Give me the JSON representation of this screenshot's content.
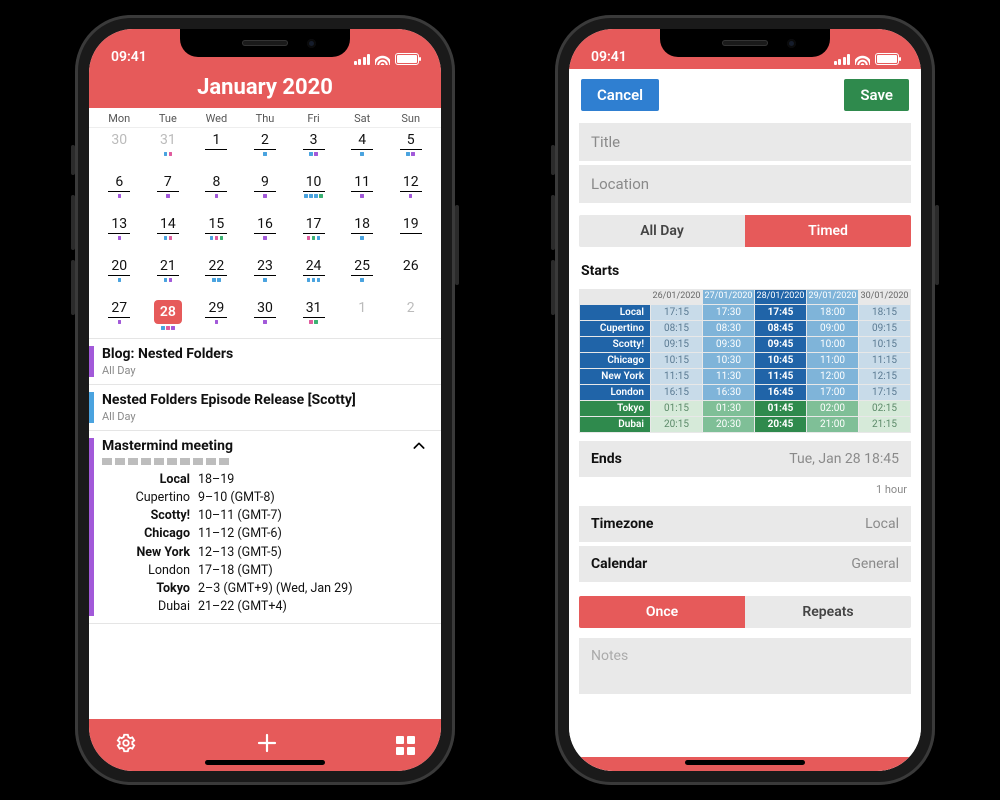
{
  "status": {
    "time": "09:41"
  },
  "calendar": {
    "title": "January 2020",
    "weekdays": [
      "Mon",
      "Tue",
      "Wed",
      "Thu",
      "Fri",
      "Sat",
      "Sun"
    ],
    "weeks": [
      [
        {
          "n": "30",
          "other": true,
          "dots": []
        },
        {
          "n": "31",
          "other": true,
          "dots": [
            "#4aa3df",
            "#e05c9e"
          ]
        },
        {
          "n": "1",
          "dots": []
        },
        {
          "n": "2",
          "dots": [
            "#4aa3df"
          ]
        },
        {
          "n": "3",
          "dots": [
            "#4aa3df",
            "#a259d9"
          ]
        },
        {
          "n": "4",
          "dots": [
            "#4aa3df"
          ]
        },
        {
          "n": "5",
          "dots": [
            "#4aa3df",
            "#a259d9"
          ]
        }
      ],
      [
        {
          "n": "6",
          "dots": [
            "#a259d9"
          ]
        },
        {
          "n": "7",
          "dots": [
            "#a259d9"
          ]
        },
        {
          "n": "8",
          "dots": [
            "#a259d9"
          ]
        },
        {
          "n": "9",
          "dots": [
            "#a259d9"
          ]
        },
        {
          "n": "10",
          "dots": [
            "#4aa3df",
            "#4aa3df",
            "#4aa3df",
            "#3bb273"
          ]
        },
        {
          "n": "11",
          "dots": [
            "#a259d9"
          ]
        },
        {
          "n": "12",
          "dots": [
            "#a259d9"
          ]
        }
      ],
      [
        {
          "n": "13",
          "dots": [
            "#a259d9"
          ]
        },
        {
          "n": "14",
          "dots": [
            "#4aa3df",
            "#e05c9e"
          ]
        },
        {
          "n": "15",
          "dots": [
            "#4aa3df",
            "#e05c9e",
            "#3bb273"
          ]
        },
        {
          "n": "16",
          "dots": [
            "#a259d9"
          ]
        },
        {
          "n": "17",
          "dots": [
            "#e05c9e",
            "#3bb273",
            "#4aa3df"
          ]
        },
        {
          "n": "18",
          "dots": [
            "#4aa3df"
          ]
        },
        {
          "n": "19",
          "dots": []
        }
      ],
      [
        {
          "n": "20",
          "dots": [
            "#4aa3df"
          ]
        },
        {
          "n": "21",
          "dots": [
            "#4aa3df",
            "#a259d9"
          ]
        },
        {
          "n": "22",
          "dots": [
            "#4aa3df",
            "#4aa3df"
          ]
        },
        {
          "n": "23",
          "dots": [
            "#4aa3df"
          ]
        },
        {
          "n": "24",
          "dots": [
            "#4aa3df",
            "#4aa3df",
            "#4aa3df"
          ]
        },
        {
          "n": "25",
          "dots": [
            "#4aa3df"
          ]
        },
        {
          "n": "26",
          "noline": true,
          "dots": []
        }
      ],
      [
        {
          "n": "27",
          "dots": [
            "#a259d9"
          ]
        },
        {
          "n": "28",
          "selected": true,
          "dots": [
            "#4aa3df",
            "#e05c9e",
            "#a259d9"
          ]
        },
        {
          "n": "29",
          "dots": [
            "#a259d9"
          ]
        },
        {
          "n": "30",
          "dots": [
            "#a259d9"
          ]
        },
        {
          "n": "31",
          "dots": [
            "#e05c9e",
            "#3bb273"
          ]
        },
        {
          "n": "1",
          "other": true,
          "noline": true,
          "dots": []
        },
        {
          "n": "2",
          "other": true,
          "noline": true,
          "dots": []
        }
      ]
    ],
    "events": [
      {
        "color": "#a259d9",
        "title": "Blog: Nested Folders",
        "sub": "All Day"
      },
      {
        "color": "#4aa3df",
        "title": "Nested Folders Episode Release [Scotty]",
        "sub": "All Day"
      }
    ],
    "mastermind": {
      "color": "#a259d9",
      "title": "Mastermind meeting",
      "rows": [
        {
          "label": "Local",
          "bold": true,
          "detail": "18–19"
        },
        {
          "label": "Cupertino",
          "bold": false,
          "detail": "9–10 (GMT-8)"
        },
        {
          "label": "Scotty!",
          "bold": true,
          "detail": "10–11 (GMT-7)"
        },
        {
          "label": "Chicago",
          "bold": true,
          "detail": "11–12 (GMT-6)"
        },
        {
          "label": "New York",
          "bold": true,
          "detail": "12–13 (GMT-5)"
        },
        {
          "label": "London",
          "bold": false,
          "detail": "17–18 (GMT)"
        },
        {
          "label": "Tokyo",
          "bold": true,
          "detail": "2–3 (GMT+9) (Wed, Jan 29)"
        },
        {
          "label": "Dubai",
          "bold": false,
          "detail": "21–22 (GMT+4)"
        }
      ]
    }
  },
  "editor": {
    "cancel": "Cancel",
    "save": "Save",
    "title_ph": "Title",
    "location_ph": "Location",
    "seg_allday": "All Day",
    "seg_timed": "Timed",
    "starts": "Starts",
    "dates": [
      "26/01/2020",
      "27/01/2020",
      "28/01/2020",
      "29/01/2020",
      "30/01/2020"
    ],
    "tz_rows": [
      {
        "label": "Local",
        "style": "blue",
        "cells": [
          "17:15",
          "17:30",
          "17:45",
          "18:00",
          "18:15"
        ]
      },
      {
        "label": "Cupertino",
        "style": "blue",
        "cells": [
          "08:15",
          "08:30",
          "08:45",
          "09:00",
          "09:15"
        ]
      },
      {
        "label": "Scotty!",
        "style": "blue",
        "cells": [
          "09:15",
          "09:30",
          "09:45",
          "10:00",
          "10:15"
        ]
      },
      {
        "label": "Chicago",
        "style": "blue",
        "cells": [
          "10:15",
          "10:30",
          "10:45",
          "11:00",
          "11:15"
        ]
      },
      {
        "label": "New York",
        "style": "blue",
        "cells": [
          "11:15",
          "11:30",
          "11:45",
          "12:00",
          "12:15"
        ]
      },
      {
        "label": "London",
        "style": "blue",
        "cells": [
          "16:15",
          "16:30",
          "16:45",
          "17:00",
          "17:15"
        ]
      },
      {
        "label": "Tokyo",
        "style": "green",
        "cells": [
          "01:15",
          "01:30",
          "01:45",
          "02:00",
          "02:15"
        ]
      },
      {
        "label": "Dubai",
        "style": "green",
        "cells": [
          "20:15",
          "20:30",
          "20:45",
          "21:00",
          "21:15"
        ]
      }
    ],
    "ends_k": "Ends",
    "ends_v": "Tue, Jan 28 18:45",
    "duration": "1 hour",
    "timezone_k": "Timezone",
    "timezone_v": "Local",
    "calendar_k": "Calendar",
    "calendar_v": "General",
    "seg_once": "Once",
    "seg_repeats": "Repeats",
    "notes_ph": "Notes"
  }
}
